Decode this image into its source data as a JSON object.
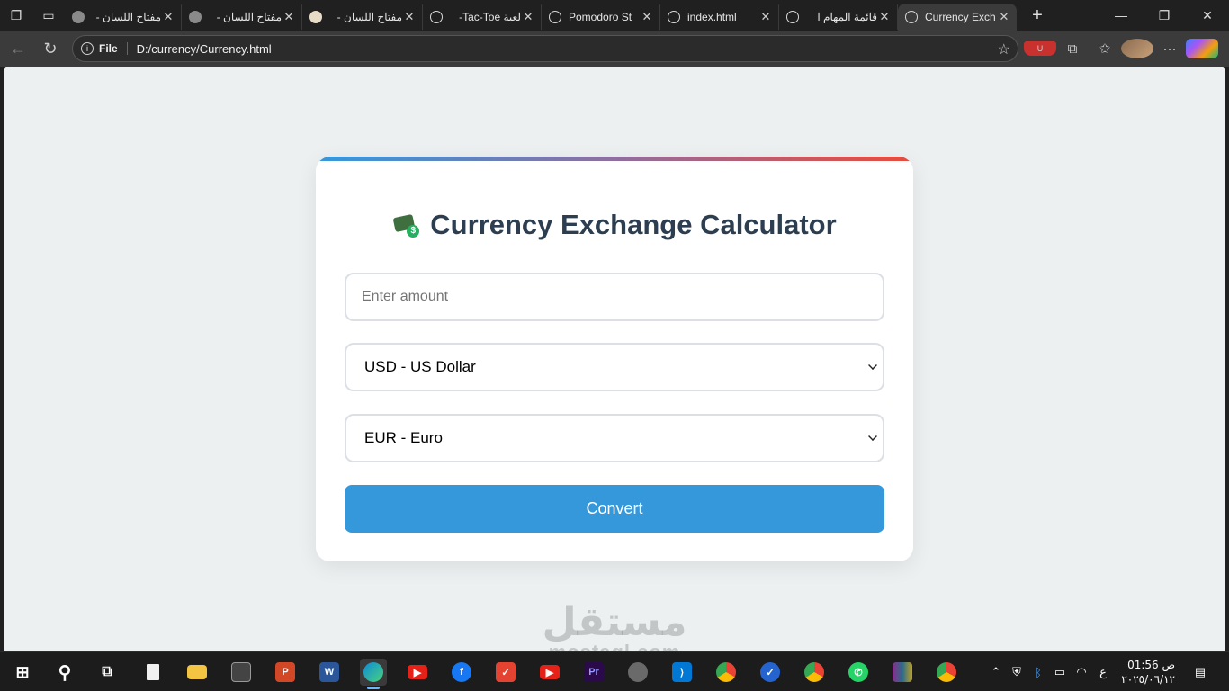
{
  "browser": {
    "tabs": [
      {
        "title": "مفتاح اللسان -",
        "favicon": "grey-dot-icon"
      },
      {
        "title": "مفتاح اللسان -",
        "favicon": "grey-dot-icon"
      },
      {
        "title": "مفتاح اللسان -",
        "favicon": "site-icon"
      },
      {
        "title": "لعبة Tac-Toe-",
        "favicon": "globe-icon"
      },
      {
        "title": "Pomodoro St",
        "favicon": "globe-icon"
      },
      {
        "title": "index.html",
        "favicon": "globe-icon"
      },
      {
        "title": "قائمة المهام ا",
        "favicon": "globe-icon"
      },
      {
        "title": "Currency Exch",
        "favicon": "globe-icon",
        "active": true
      }
    ],
    "address": {
      "scheme_label": "File",
      "url": "D:/currency/Currency.html"
    }
  },
  "page": {
    "title": "Currency Exchange Calculator",
    "amount_placeholder": "Enter amount",
    "from_currency": "USD - US Dollar",
    "to_currency": "EUR - Euro",
    "convert_label": "Convert",
    "accent_color": "#3498db",
    "title_color": "#2c3e50"
  },
  "watermark": {
    "arabic": "مستقل",
    "latin": "mostaql.com"
  },
  "taskbar": {
    "clock_time": "01:56 ص",
    "clock_date": "٢٠٢٥/٠٦/١٢",
    "input_lang": "ع"
  }
}
